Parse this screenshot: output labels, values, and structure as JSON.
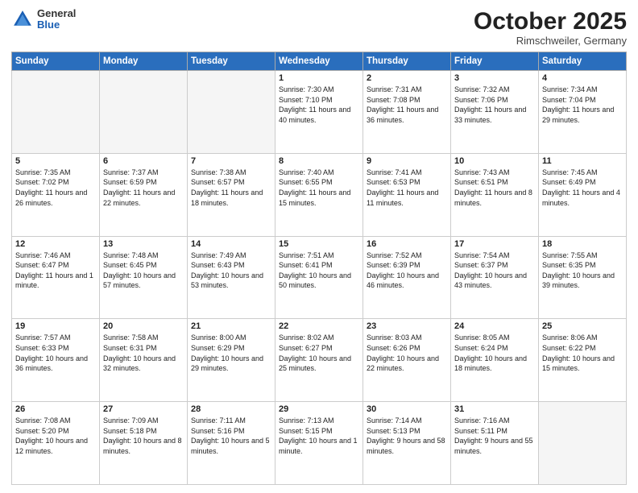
{
  "header": {
    "logo_general": "General",
    "logo_blue": "Blue",
    "month": "October 2025",
    "location": "Rimschweiler, Germany"
  },
  "weekdays": [
    "Sunday",
    "Monday",
    "Tuesday",
    "Wednesday",
    "Thursday",
    "Friday",
    "Saturday"
  ],
  "weeks": [
    [
      {
        "day": "",
        "info": ""
      },
      {
        "day": "",
        "info": ""
      },
      {
        "day": "",
        "info": ""
      },
      {
        "day": "1",
        "info": "Sunrise: 7:30 AM\nSunset: 7:10 PM\nDaylight: 11 hours\nand 40 minutes."
      },
      {
        "day": "2",
        "info": "Sunrise: 7:31 AM\nSunset: 7:08 PM\nDaylight: 11 hours\nand 36 minutes."
      },
      {
        "day": "3",
        "info": "Sunrise: 7:32 AM\nSunset: 7:06 PM\nDaylight: 11 hours\nand 33 minutes."
      },
      {
        "day": "4",
        "info": "Sunrise: 7:34 AM\nSunset: 7:04 PM\nDaylight: 11 hours\nand 29 minutes."
      }
    ],
    [
      {
        "day": "5",
        "info": "Sunrise: 7:35 AM\nSunset: 7:02 PM\nDaylight: 11 hours\nand 26 minutes."
      },
      {
        "day": "6",
        "info": "Sunrise: 7:37 AM\nSunset: 6:59 PM\nDaylight: 11 hours\nand 22 minutes."
      },
      {
        "day": "7",
        "info": "Sunrise: 7:38 AM\nSunset: 6:57 PM\nDaylight: 11 hours\nand 18 minutes."
      },
      {
        "day": "8",
        "info": "Sunrise: 7:40 AM\nSunset: 6:55 PM\nDaylight: 11 hours\nand 15 minutes."
      },
      {
        "day": "9",
        "info": "Sunrise: 7:41 AM\nSunset: 6:53 PM\nDaylight: 11 hours\nand 11 minutes."
      },
      {
        "day": "10",
        "info": "Sunrise: 7:43 AM\nSunset: 6:51 PM\nDaylight: 11 hours\nand 8 minutes."
      },
      {
        "day": "11",
        "info": "Sunrise: 7:45 AM\nSunset: 6:49 PM\nDaylight: 11 hours\nand 4 minutes."
      }
    ],
    [
      {
        "day": "12",
        "info": "Sunrise: 7:46 AM\nSunset: 6:47 PM\nDaylight: 11 hours\nand 1 minute."
      },
      {
        "day": "13",
        "info": "Sunrise: 7:48 AM\nSunset: 6:45 PM\nDaylight: 10 hours\nand 57 minutes."
      },
      {
        "day": "14",
        "info": "Sunrise: 7:49 AM\nSunset: 6:43 PM\nDaylight: 10 hours\nand 53 minutes."
      },
      {
        "day": "15",
        "info": "Sunrise: 7:51 AM\nSunset: 6:41 PM\nDaylight: 10 hours\nand 50 minutes."
      },
      {
        "day": "16",
        "info": "Sunrise: 7:52 AM\nSunset: 6:39 PM\nDaylight: 10 hours\nand 46 minutes."
      },
      {
        "day": "17",
        "info": "Sunrise: 7:54 AM\nSunset: 6:37 PM\nDaylight: 10 hours\nand 43 minutes."
      },
      {
        "day": "18",
        "info": "Sunrise: 7:55 AM\nSunset: 6:35 PM\nDaylight: 10 hours\nand 39 minutes."
      }
    ],
    [
      {
        "day": "19",
        "info": "Sunrise: 7:57 AM\nSunset: 6:33 PM\nDaylight: 10 hours\nand 36 minutes."
      },
      {
        "day": "20",
        "info": "Sunrise: 7:58 AM\nSunset: 6:31 PM\nDaylight: 10 hours\nand 32 minutes."
      },
      {
        "day": "21",
        "info": "Sunrise: 8:00 AM\nSunset: 6:29 PM\nDaylight: 10 hours\nand 29 minutes."
      },
      {
        "day": "22",
        "info": "Sunrise: 8:02 AM\nSunset: 6:27 PM\nDaylight: 10 hours\nand 25 minutes."
      },
      {
        "day": "23",
        "info": "Sunrise: 8:03 AM\nSunset: 6:26 PM\nDaylight: 10 hours\nand 22 minutes."
      },
      {
        "day": "24",
        "info": "Sunrise: 8:05 AM\nSunset: 6:24 PM\nDaylight: 10 hours\nand 18 minutes."
      },
      {
        "day": "25",
        "info": "Sunrise: 8:06 AM\nSunset: 6:22 PM\nDaylight: 10 hours\nand 15 minutes."
      }
    ],
    [
      {
        "day": "26",
        "info": "Sunrise: 7:08 AM\nSunset: 5:20 PM\nDaylight: 10 hours\nand 12 minutes."
      },
      {
        "day": "27",
        "info": "Sunrise: 7:09 AM\nSunset: 5:18 PM\nDaylight: 10 hours\nand 8 minutes."
      },
      {
        "day": "28",
        "info": "Sunrise: 7:11 AM\nSunset: 5:16 PM\nDaylight: 10 hours\nand 5 minutes."
      },
      {
        "day": "29",
        "info": "Sunrise: 7:13 AM\nSunset: 5:15 PM\nDaylight: 10 hours\nand 1 minute."
      },
      {
        "day": "30",
        "info": "Sunrise: 7:14 AM\nSunset: 5:13 PM\nDaylight: 9 hours\nand 58 minutes."
      },
      {
        "day": "31",
        "info": "Sunrise: 7:16 AM\nSunset: 5:11 PM\nDaylight: 9 hours\nand 55 minutes."
      },
      {
        "day": "",
        "info": ""
      }
    ]
  ]
}
